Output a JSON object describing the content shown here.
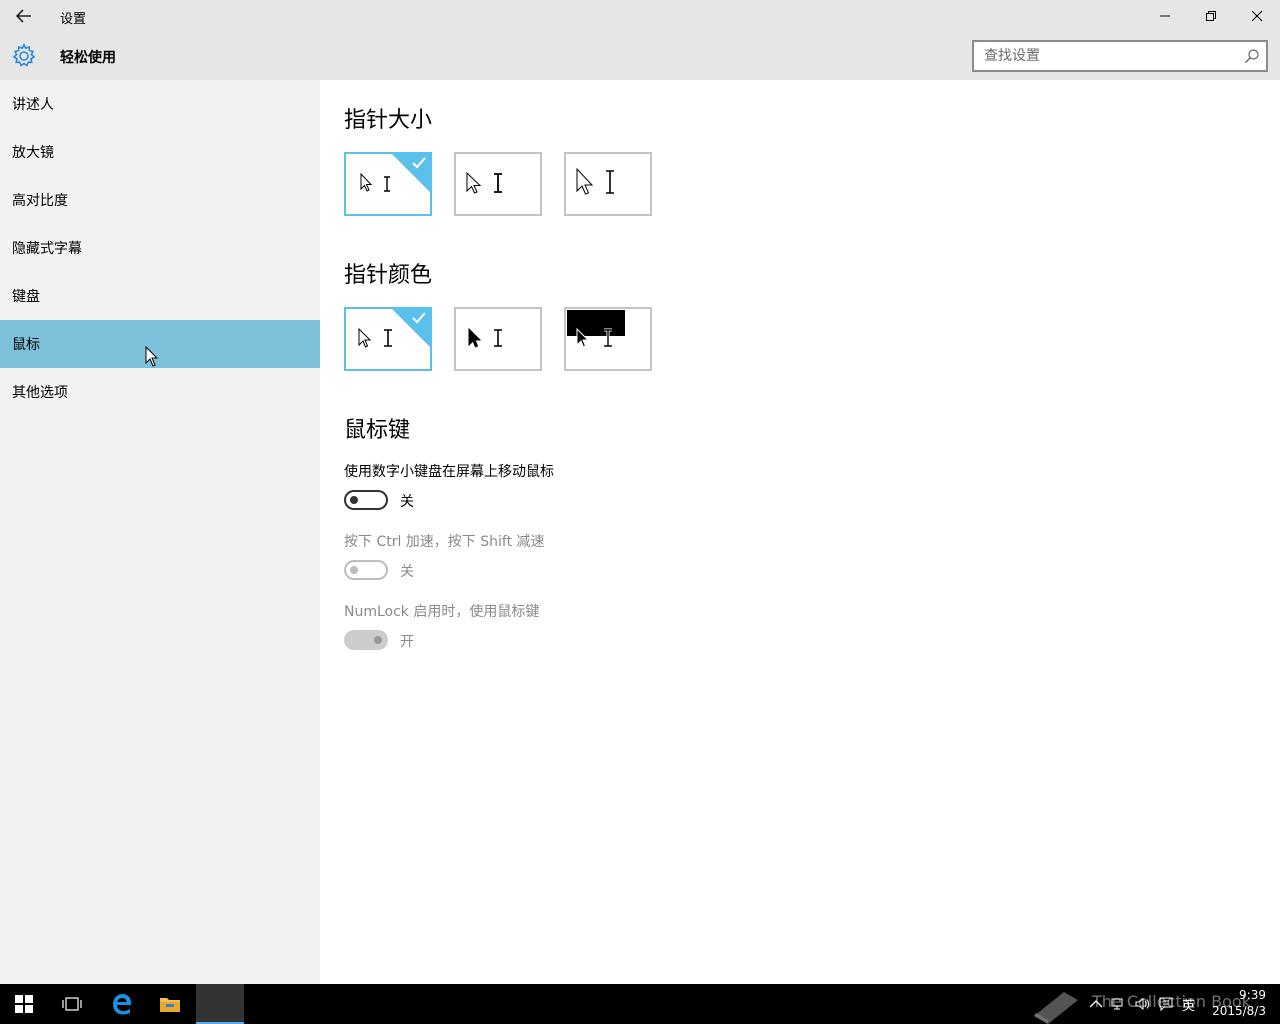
{
  "window": {
    "title": "设置"
  },
  "header": {
    "title": "轻松使用",
    "search_placeholder": "查找设置"
  },
  "sidebar": {
    "items": [
      {
        "label": "讲述人"
      },
      {
        "label": "放大镜"
      },
      {
        "label": "高对比度"
      },
      {
        "label": "隐藏式字幕"
      },
      {
        "label": "键盘"
      },
      {
        "label": "鼠标",
        "selected": true
      },
      {
        "label": "其他选项"
      }
    ]
  },
  "pointer_size": {
    "title": "指针大小",
    "selected_index": 0
  },
  "pointer_color": {
    "title": "指针颜色",
    "selected_index": 0
  },
  "mouse_keys": {
    "title": "鼠标键",
    "settings": [
      {
        "label": "使用数字小键盘在屏幕上移动鼠标",
        "state": "关",
        "on": false,
        "enabled": true
      },
      {
        "label": "按下 Ctrl 加速，按下 Shift 减速",
        "state": "关",
        "on": false,
        "enabled": false
      },
      {
        "label": "NumLock 启用时，使用鼠标键",
        "state": "开",
        "on": true,
        "enabled": false
      }
    ]
  },
  "taskbar": {
    "time": "9:39",
    "date": "2015/8/3",
    "language": "英",
    "watermark": "The Collection Book"
  },
  "colors": {
    "accent": "#5bc0ec",
    "selected_nav": "#7ec1da"
  }
}
